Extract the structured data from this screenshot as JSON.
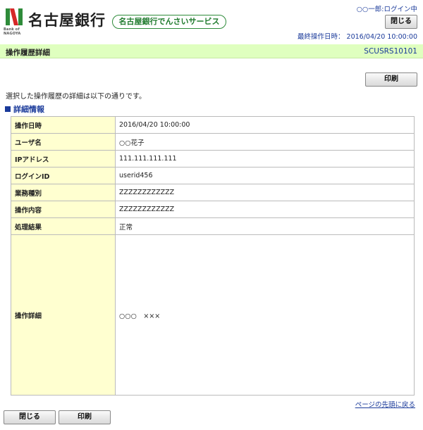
{
  "header": {
    "bank_name": "名古屋銀行",
    "logo_subtext": "Bank of NAGOYA",
    "service_name": "名古屋銀行でんさいサービス",
    "login_status": "○○一郎:ログイン中",
    "close_label": "閉じる",
    "last_op_label": "最終操作日時：",
    "last_op_value": "2016/04/20 10:00:00"
  },
  "title_bar": {
    "title": "操作履歴詳細",
    "screen_id": "SCUSRS10101"
  },
  "toolbar": {
    "print_label": "印刷"
  },
  "description": "選択した操作履歴の詳細は以下の通りです。",
  "section": {
    "heading": "詳細情報"
  },
  "details": [
    {
      "label": "操作日時",
      "value": "2016/04/20 10:00:00"
    },
    {
      "label": "ユーザ名",
      "value": "○○花子"
    },
    {
      "label": "IPアドレス",
      "value": "111.111.111.111"
    },
    {
      "label": "ログインID",
      "value": "userid456"
    },
    {
      "label": "業務種別",
      "value": "ZZZZZZZZZZZZ"
    },
    {
      "label": "操作内容",
      "value": "ZZZZZZZZZZZZ"
    },
    {
      "label": "処理結果",
      "value": "正常"
    },
    {
      "label": "操作詳細",
      "value": "○○○　×××"
    }
  ],
  "footer": {
    "back_to_top": "ページの先頭に戻る",
    "close_label": "閉じる",
    "print_label": "印刷"
  },
  "colors": {
    "accent_green": "#2e8b3a",
    "title_bar_bg": "#dfffbf",
    "label_bg": "#ffffd0",
    "link_blue": "#1a3a9a"
  }
}
